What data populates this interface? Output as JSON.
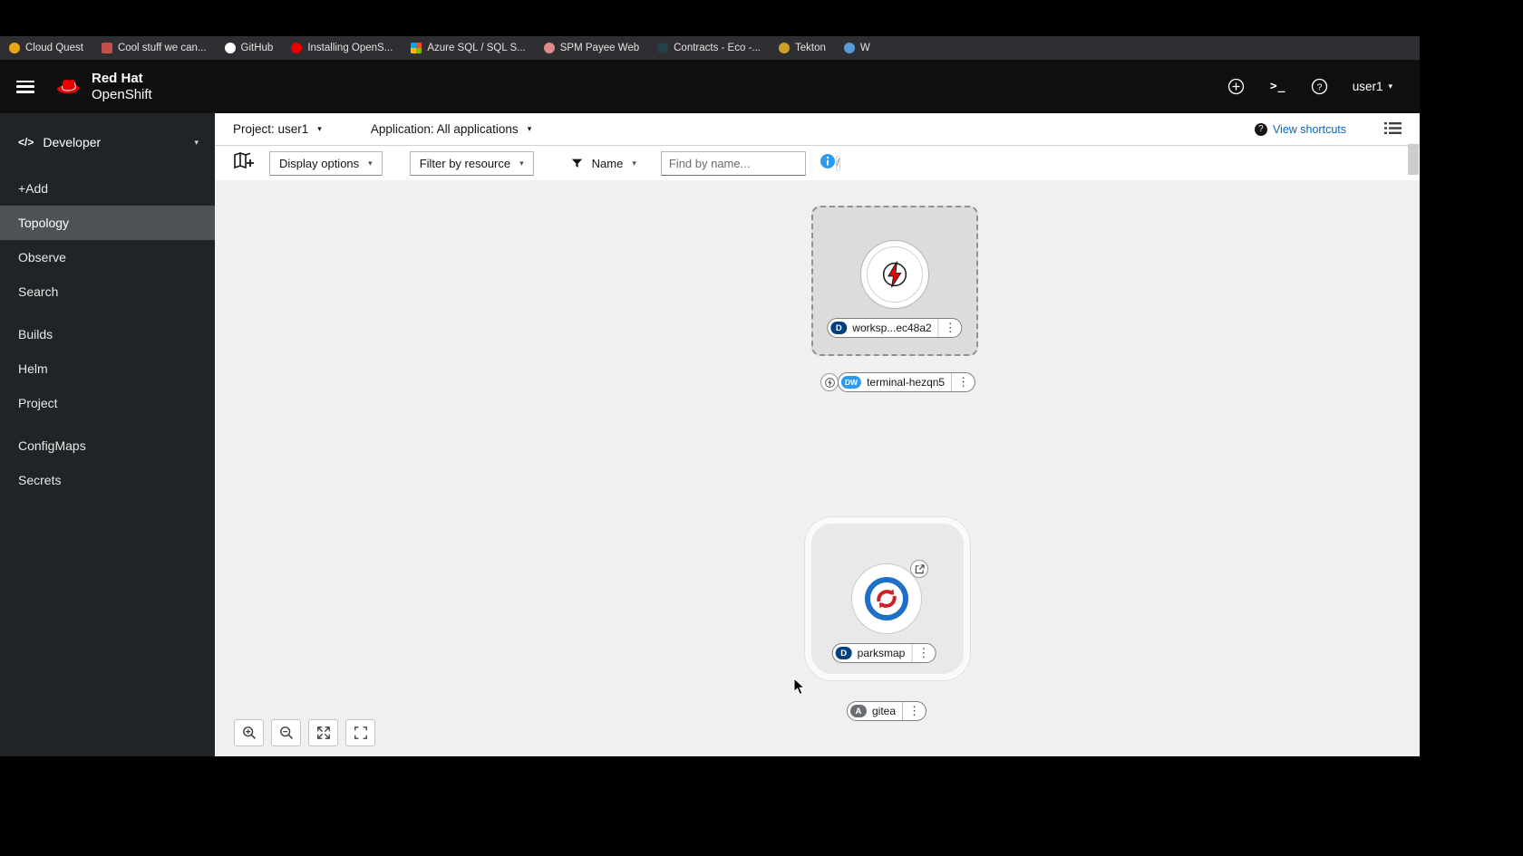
{
  "bookmarks": {
    "items": [
      {
        "label": "Cloud Quest"
      },
      {
        "label": "Cool stuff we can..."
      },
      {
        "label": "GitHub"
      },
      {
        "label": "Installing OpenS..."
      },
      {
        "label": "Azure SQL / SQL S..."
      },
      {
        "label": "SPM Payee Web"
      },
      {
        "label": "Contracts - Eco -..."
      },
      {
        "label": "Tekton"
      },
      {
        "label": "W"
      }
    ]
  },
  "masthead": {
    "brand_top": "Red Hat",
    "brand_bottom": "OpenShift",
    "user_menu": "user1"
  },
  "sidebar": {
    "perspective": "Developer",
    "items": [
      {
        "label": "+Add"
      },
      {
        "label": "Topology"
      },
      {
        "label": "Observe"
      },
      {
        "label": "Search"
      },
      {
        "label": "Builds"
      },
      {
        "label": "Helm"
      },
      {
        "label": "Project"
      },
      {
        "label": "ConfigMaps"
      },
      {
        "label": "Secrets"
      }
    ]
  },
  "context_bar": {
    "project": "Project: user1",
    "application": "Application: All applications",
    "view_shortcuts": "View shortcuts"
  },
  "toolbar": {
    "display_options": "Display options",
    "filter_by_resource": "Filter by resource",
    "name_filter": "Name",
    "find_placeholder": "Find by name...",
    "shortcut_hint": "/"
  },
  "topology": {
    "workspace": {
      "badge": "D",
      "label": "worksp...ec48a2"
    },
    "terminal": {
      "badge": "DW",
      "label": "terminal-hezqn5"
    },
    "parksmap": {
      "badge": "D",
      "label": "parksmap"
    },
    "gitea": {
      "badge": "A",
      "label": "gitea"
    }
  },
  "icons": {
    "kebab": "⋮",
    "caret_down": "▾",
    "code": "</>",
    "terminal_glyph": ">_"
  },
  "colors": {
    "brand_red": "#ee0000",
    "accent_blue": "#0066cc",
    "badge_deployment": "#004080",
    "badge_devworkspace": "#2b9af3",
    "badge_gray": "#6a6e73",
    "sidebar_bg": "#212427",
    "canvas_bg": "#f0f0f0"
  }
}
